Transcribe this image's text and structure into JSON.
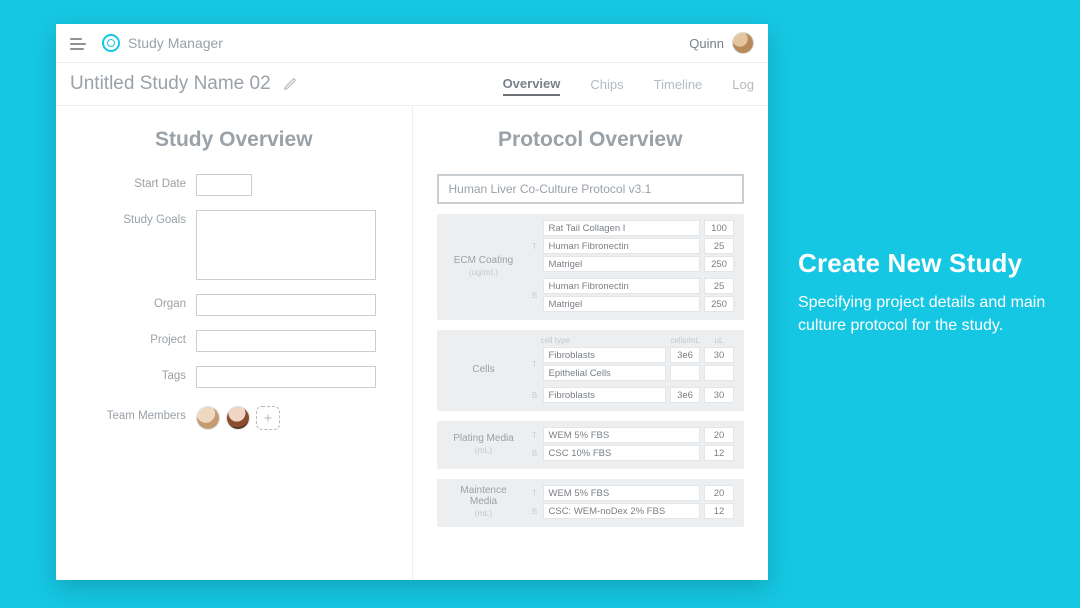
{
  "header": {
    "app_title": "Study Manager",
    "username": "Quinn"
  },
  "subheader": {
    "study_name": "Untitled Study Name 02",
    "tabs": {
      "overview": "Overview",
      "chips": "Chips",
      "timeline": "Timeline",
      "log": "Log"
    }
  },
  "study": {
    "section_title": "Study Overview",
    "labels": {
      "start_date": "Start Date",
      "study_goals": "Study Goals",
      "organ": "Organ",
      "project": "Project",
      "tags": "Tags",
      "team_members": "Team Members"
    }
  },
  "protocol": {
    "section_title": "Protocol Overview",
    "name_field": "Human Liver Co-Culture Protocol v3.1",
    "ecm": {
      "label": "ECM Coating",
      "unit": "(ug/mL)",
      "top": [
        {
          "name": "Rat Tail Collagen I",
          "val": "100"
        },
        {
          "name": "Human Fibronectin",
          "val": "25"
        },
        {
          "name": "Matrigel",
          "val": "250"
        }
      ],
      "bottom": [
        {
          "name": "Human Fibronectin",
          "val": "25"
        },
        {
          "name": "Matrigel",
          "val": "250"
        }
      ]
    },
    "cells": {
      "label": "Cells",
      "col1": "cell type",
      "col2": "cells/mL",
      "col3": "uL",
      "top": [
        {
          "name": "Fibroblasts",
          "v1": "3e6",
          "v2": "30"
        },
        {
          "name": "Epithelial Cells",
          "v1": "",
          "v2": ""
        }
      ],
      "bottom": [
        {
          "name": "Fibroblasts",
          "v1": "3e6",
          "v2": "30"
        }
      ]
    },
    "plating": {
      "label": "Plating Media",
      "unit": "(mL)",
      "top": {
        "name": "WEM 5% FBS",
        "val": "20"
      },
      "bottom": {
        "name": "CSC 10% FBS",
        "val": "12"
      }
    },
    "maint": {
      "label": "Maintence Media",
      "unit": "(mL)",
      "top": {
        "name": "WEM 5% FBS",
        "val": "20"
      },
      "bottom": {
        "name": "CSC: WEM-noDex 2% FBS",
        "val": "12"
      }
    }
  },
  "explainer": {
    "title": "Create New Study",
    "body": "Specifying project details and main culture protocol for the study."
  },
  "channels": {
    "top": "T",
    "bottom": "B"
  }
}
